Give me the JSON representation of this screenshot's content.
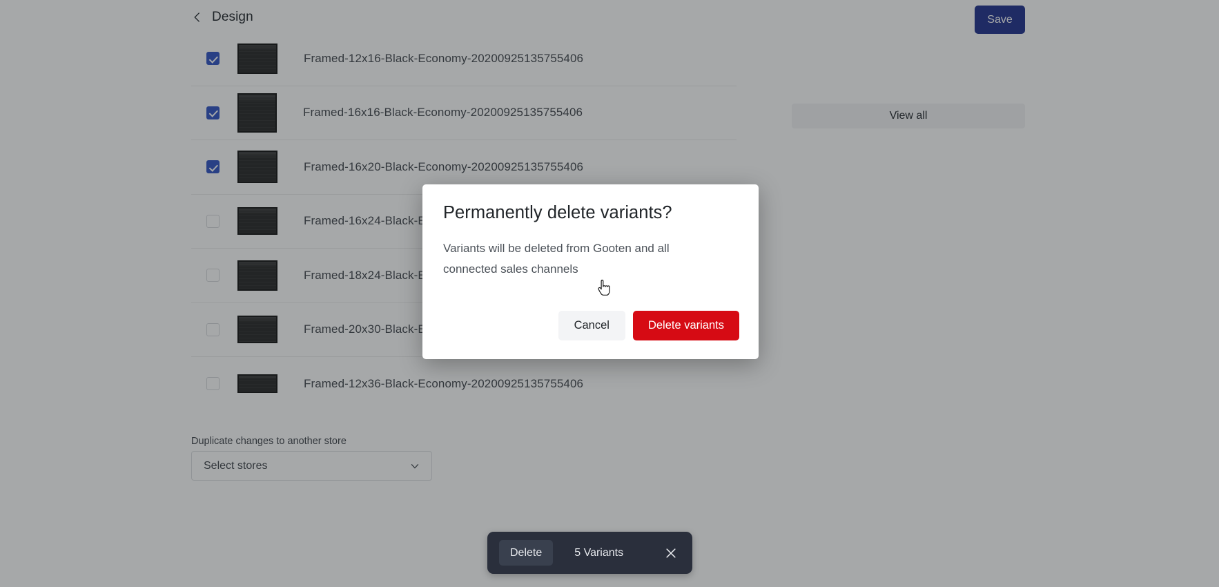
{
  "header": {
    "back_icon": "chevron-left-icon",
    "title": "Design",
    "save_label": "Save"
  },
  "sidebar_panel": {
    "view_all_label": "View all"
  },
  "variants": {
    "rows": [
      {
        "name": "Framed-12x16-Black-Economy-20200925135755406",
        "checked": true,
        "thumb_w": 58,
        "thumb_h": 44
      },
      {
        "name": "Framed-16x16-Black-Economy-20200925135755406",
        "checked": true,
        "thumb_w": 57,
        "thumb_h": 57
      },
      {
        "name": "Framed-16x20-Black-Economy-20200925135755406",
        "checked": true,
        "thumb_w": 58,
        "thumb_h": 47
      },
      {
        "name": "Framed-16x24-Black-Economy-20200925135755406",
        "checked": false,
        "thumb_w": 58,
        "thumb_h": 40
      },
      {
        "name": "Framed-18x24-Black-Economy-20200925135755406",
        "checked": false,
        "thumb_w": 58,
        "thumb_h": 44
      },
      {
        "name": "Framed-20x30-Black-Economy-20200925135755406",
        "checked": false,
        "thumb_w": 58,
        "thumb_h": 40
      },
      {
        "name": "Framed-12x36-Black-Economy-20200925135755406",
        "checked": false,
        "thumb_w": 58,
        "thumb_h": 27
      }
    ]
  },
  "duplicate": {
    "label": "Duplicate changes to another store",
    "select_value": "Select stores",
    "chevron_icon": "chevron-down-icon"
  },
  "action_bar": {
    "delete_label": "Delete",
    "count_label": "5 Variants",
    "close_icon": "close-icon"
  },
  "modal": {
    "title": "Permanently delete variants?",
    "body": "Variants will be deleted from Gooten and all connected sales channels",
    "cancel_label": "Cancel",
    "confirm_label": "Delete variants"
  },
  "colors": {
    "save_blue": "#1e2f8d",
    "checkbox_blue": "#2f53c4",
    "danger_red": "#d60b14",
    "action_bar_bg": "#2a2f3c",
    "scrim": "rgba(33,37,41,0.40)"
  }
}
